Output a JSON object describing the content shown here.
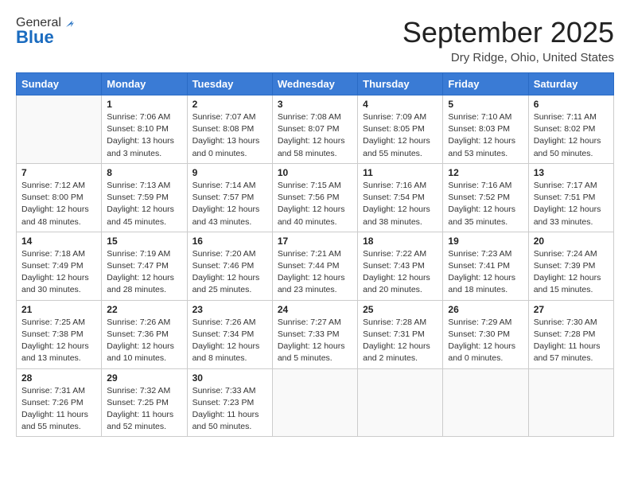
{
  "header": {
    "logo_general": "General",
    "logo_blue": "Blue",
    "month_title": "September 2025",
    "location": "Dry Ridge, Ohio, United States"
  },
  "weekdays": [
    "Sunday",
    "Monday",
    "Tuesday",
    "Wednesday",
    "Thursday",
    "Friday",
    "Saturday"
  ],
  "weeks": [
    [
      {
        "day": "",
        "info": ""
      },
      {
        "day": "1",
        "info": "Sunrise: 7:06 AM\nSunset: 8:10 PM\nDaylight: 13 hours\nand 3 minutes."
      },
      {
        "day": "2",
        "info": "Sunrise: 7:07 AM\nSunset: 8:08 PM\nDaylight: 13 hours\nand 0 minutes."
      },
      {
        "day": "3",
        "info": "Sunrise: 7:08 AM\nSunset: 8:07 PM\nDaylight: 12 hours\nand 58 minutes."
      },
      {
        "day": "4",
        "info": "Sunrise: 7:09 AM\nSunset: 8:05 PM\nDaylight: 12 hours\nand 55 minutes."
      },
      {
        "day": "5",
        "info": "Sunrise: 7:10 AM\nSunset: 8:03 PM\nDaylight: 12 hours\nand 53 minutes."
      },
      {
        "day": "6",
        "info": "Sunrise: 7:11 AM\nSunset: 8:02 PM\nDaylight: 12 hours\nand 50 minutes."
      }
    ],
    [
      {
        "day": "7",
        "info": "Sunrise: 7:12 AM\nSunset: 8:00 PM\nDaylight: 12 hours\nand 48 minutes."
      },
      {
        "day": "8",
        "info": "Sunrise: 7:13 AM\nSunset: 7:59 PM\nDaylight: 12 hours\nand 45 minutes."
      },
      {
        "day": "9",
        "info": "Sunrise: 7:14 AM\nSunset: 7:57 PM\nDaylight: 12 hours\nand 43 minutes."
      },
      {
        "day": "10",
        "info": "Sunrise: 7:15 AM\nSunset: 7:56 PM\nDaylight: 12 hours\nand 40 minutes."
      },
      {
        "day": "11",
        "info": "Sunrise: 7:16 AM\nSunset: 7:54 PM\nDaylight: 12 hours\nand 38 minutes."
      },
      {
        "day": "12",
        "info": "Sunrise: 7:16 AM\nSunset: 7:52 PM\nDaylight: 12 hours\nand 35 minutes."
      },
      {
        "day": "13",
        "info": "Sunrise: 7:17 AM\nSunset: 7:51 PM\nDaylight: 12 hours\nand 33 minutes."
      }
    ],
    [
      {
        "day": "14",
        "info": "Sunrise: 7:18 AM\nSunset: 7:49 PM\nDaylight: 12 hours\nand 30 minutes."
      },
      {
        "day": "15",
        "info": "Sunrise: 7:19 AM\nSunset: 7:47 PM\nDaylight: 12 hours\nand 28 minutes."
      },
      {
        "day": "16",
        "info": "Sunrise: 7:20 AM\nSunset: 7:46 PM\nDaylight: 12 hours\nand 25 minutes."
      },
      {
        "day": "17",
        "info": "Sunrise: 7:21 AM\nSunset: 7:44 PM\nDaylight: 12 hours\nand 23 minutes."
      },
      {
        "day": "18",
        "info": "Sunrise: 7:22 AM\nSunset: 7:43 PM\nDaylight: 12 hours\nand 20 minutes."
      },
      {
        "day": "19",
        "info": "Sunrise: 7:23 AM\nSunset: 7:41 PM\nDaylight: 12 hours\nand 18 minutes."
      },
      {
        "day": "20",
        "info": "Sunrise: 7:24 AM\nSunset: 7:39 PM\nDaylight: 12 hours\nand 15 minutes."
      }
    ],
    [
      {
        "day": "21",
        "info": "Sunrise: 7:25 AM\nSunset: 7:38 PM\nDaylight: 12 hours\nand 13 minutes."
      },
      {
        "day": "22",
        "info": "Sunrise: 7:26 AM\nSunset: 7:36 PM\nDaylight: 12 hours\nand 10 minutes."
      },
      {
        "day": "23",
        "info": "Sunrise: 7:26 AM\nSunset: 7:34 PM\nDaylight: 12 hours\nand 8 minutes."
      },
      {
        "day": "24",
        "info": "Sunrise: 7:27 AM\nSunset: 7:33 PM\nDaylight: 12 hours\nand 5 minutes."
      },
      {
        "day": "25",
        "info": "Sunrise: 7:28 AM\nSunset: 7:31 PM\nDaylight: 12 hours\nand 2 minutes."
      },
      {
        "day": "26",
        "info": "Sunrise: 7:29 AM\nSunset: 7:30 PM\nDaylight: 12 hours\nand 0 minutes."
      },
      {
        "day": "27",
        "info": "Sunrise: 7:30 AM\nSunset: 7:28 PM\nDaylight: 11 hours\nand 57 minutes."
      }
    ],
    [
      {
        "day": "28",
        "info": "Sunrise: 7:31 AM\nSunset: 7:26 PM\nDaylight: 11 hours\nand 55 minutes."
      },
      {
        "day": "29",
        "info": "Sunrise: 7:32 AM\nSunset: 7:25 PM\nDaylight: 11 hours\nand 52 minutes."
      },
      {
        "day": "30",
        "info": "Sunrise: 7:33 AM\nSunset: 7:23 PM\nDaylight: 11 hours\nand 50 minutes."
      },
      {
        "day": "",
        "info": ""
      },
      {
        "day": "",
        "info": ""
      },
      {
        "day": "",
        "info": ""
      },
      {
        "day": "",
        "info": ""
      }
    ]
  ]
}
